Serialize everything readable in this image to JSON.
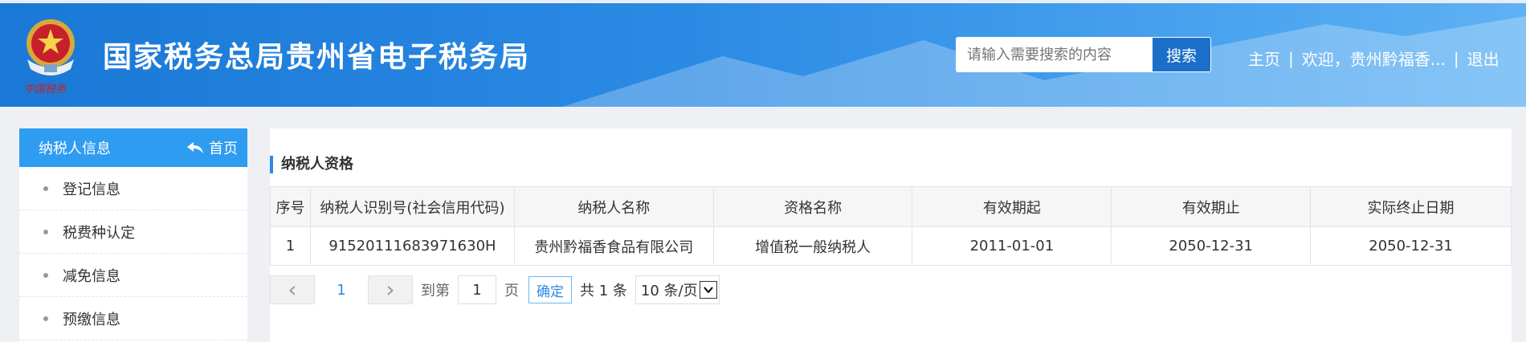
{
  "header": {
    "logo_text": "中国税务",
    "title": "国家税务总局贵州省电子税务局",
    "search_placeholder": "请输入需要搜索的内容",
    "search_button": "搜索",
    "nav": {
      "home": "主页",
      "sep1": "|",
      "welcome": "欢迎，贵州黔福香...",
      "sep2": "|",
      "logout": "退出"
    }
  },
  "sidebar": {
    "title": "纳税人信息",
    "home_link": "首页",
    "items": [
      {
        "label": "登记信息"
      },
      {
        "label": "税费种认定"
      },
      {
        "label": "减免信息"
      },
      {
        "label": "预缴信息"
      }
    ]
  },
  "content": {
    "section_title": "纳税人资格",
    "columns": [
      "序号",
      "纳税人识别号(社会信用代码)",
      "纳税人名称",
      "资格名称",
      "有效期起",
      "有效期止",
      "实际终止日期"
    ],
    "rows": [
      [
        "1",
        "91520111683971630H",
        "贵州黔福香食品有限公司",
        "增值税一般纳税人",
        "2011-01-01",
        "2050-12-31",
        "2050-12-31"
      ]
    ],
    "pager": {
      "prev": "‹",
      "current_page": "1",
      "next": "›",
      "goto_label": "到第",
      "goto_value": "1",
      "page_label": "页",
      "confirm": "确定",
      "total": "共 1 条",
      "page_size": "10 条/页"
    }
  },
  "colors": {
    "header": "#2b8ae4",
    "accent": "#2e9cf0",
    "link": "#2e89e6"
  }
}
